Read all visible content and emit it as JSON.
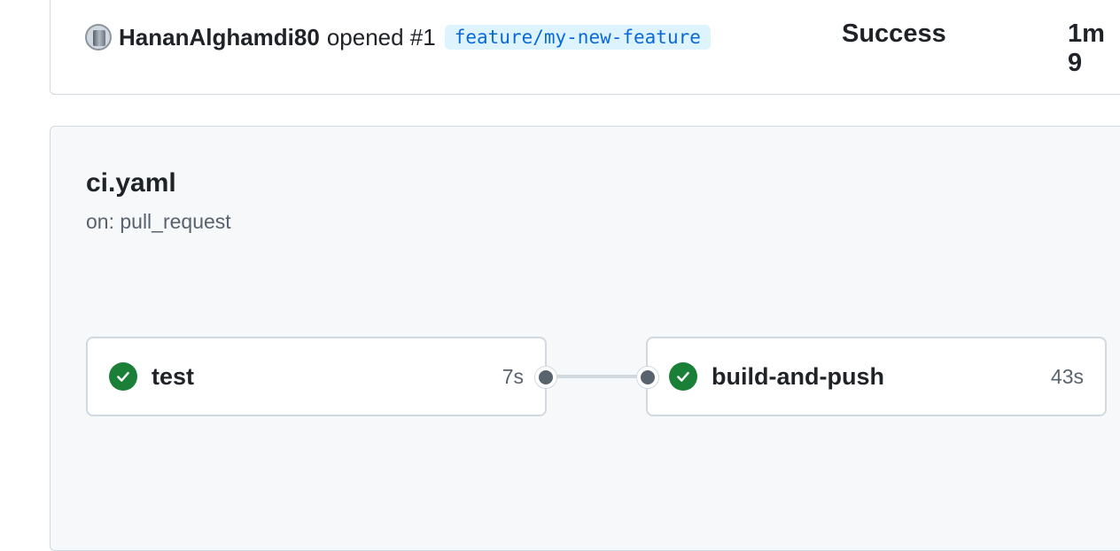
{
  "run": {
    "author": "HananAlghamdi80",
    "event_text": "opened #1",
    "branch": "feature/my-new-feature",
    "status": "Success",
    "duration": "1m 9"
  },
  "workflow": {
    "file": "ci.yaml",
    "trigger": "on: pull_request",
    "jobs": [
      {
        "name": "test",
        "duration": "7s",
        "status": "success",
        "icon": "check-circle-icon"
      },
      {
        "name": "build-and-push",
        "duration": "43s",
        "status": "success",
        "icon": "check-circle-icon"
      }
    ]
  },
  "colors": {
    "success": "#1a7f37",
    "branch_bg": "#ddf4ff",
    "branch_fg": "#0969da",
    "muted": "#59636e",
    "border": "#d1d9e0"
  }
}
